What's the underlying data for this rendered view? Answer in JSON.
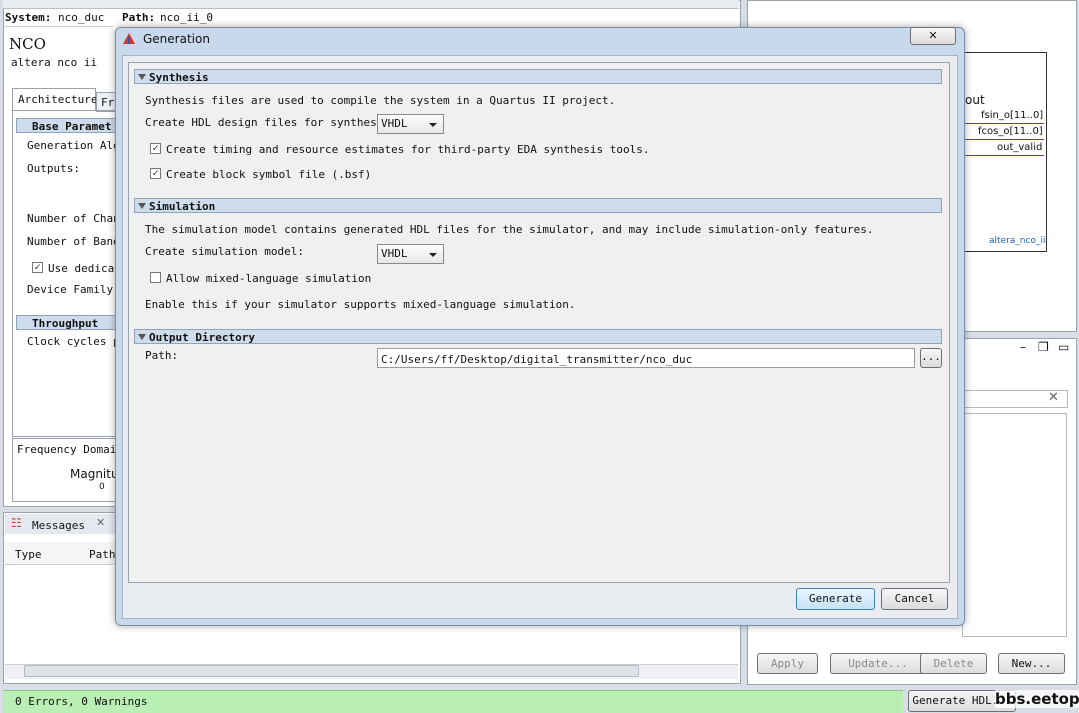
{
  "background": {
    "system_label": "System:",
    "system_value": "nco_duc",
    "path_label": "Path:",
    "path_value": "nco_ii_0",
    "nco_title": "NCO",
    "nco_subtitle": "altera nco ii",
    "tabs": [
      "Architecture",
      "Fr"
    ],
    "base_params_header": "Base Paramet",
    "generation_alg": "Generation Alg",
    "outputs": "Outputs:",
    "num_channels": "Number of Chan",
    "num_bands": "Number of Band",
    "use_dedicated": "Use dedicat",
    "device_family": "Device Family:",
    "throughput_header": "Throughput",
    "clock_cycles": "Clock cycles p",
    "freq_domain": "Frequency Domain",
    "magnitude": "Magnitu",
    "zero_tick": "0",
    "messages_tab": "Messages",
    "col_type": "Type",
    "col_path": "Path",
    "status": "0 Errors, 0 Warnings",
    "symbol_out": "out",
    "symbol_ports": [
      "fsin_o[11..0]",
      "fcos_o[11..0]",
      "out_valid"
    ],
    "symbol_name": "altera_nco_ii",
    "buttons_bottom": [
      "Apply",
      "Update...",
      "Delete",
      "New..."
    ],
    "generate_hdl": "Generate HDL...",
    "watermark": "bbs.eetop.cn"
  },
  "dialog": {
    "title": "Generation",
    "close_glyph": "✕",
    "synthesis": {
      "header": "Synthesis",
      "desc": "Synthesis files are used to compile the system in a Quartus II project.",
      "hdl_label": "Create HDL design files for synthesis:",
      "hdl_value": "VHDL",
      "timing_label": "Create timing and resource estimates for third-party EDA synthesis tools.",
      "timing_checked": true,
      "bsf_label": "Create block symbol file (.bsf)",
      "bsf_checked": true
    },
    "simulation": {
      "header": "Simulation",
      "desc": "The simulation model contains generated HDL files for the simulator, and may include simulation-only features.",
      "model_label": "Create simulation model:",
      "model_value": "VHDL",
      "mixed_label": "Allow mixed-language simulation",
      "mixed_checked": false,
      "hint": "Enable this if your simulator supports mixed-language simulation."
    },
    "output": {
      "header": "Output Directory",
      "path_label": "Path:",
      "path_value": "C:/Users/ff/Desktop/digital_transmitter/nco_duc",
      "browse": "..."
    },
    "generate": "Generate",
    "cancel": "Cancel"
  }
}
